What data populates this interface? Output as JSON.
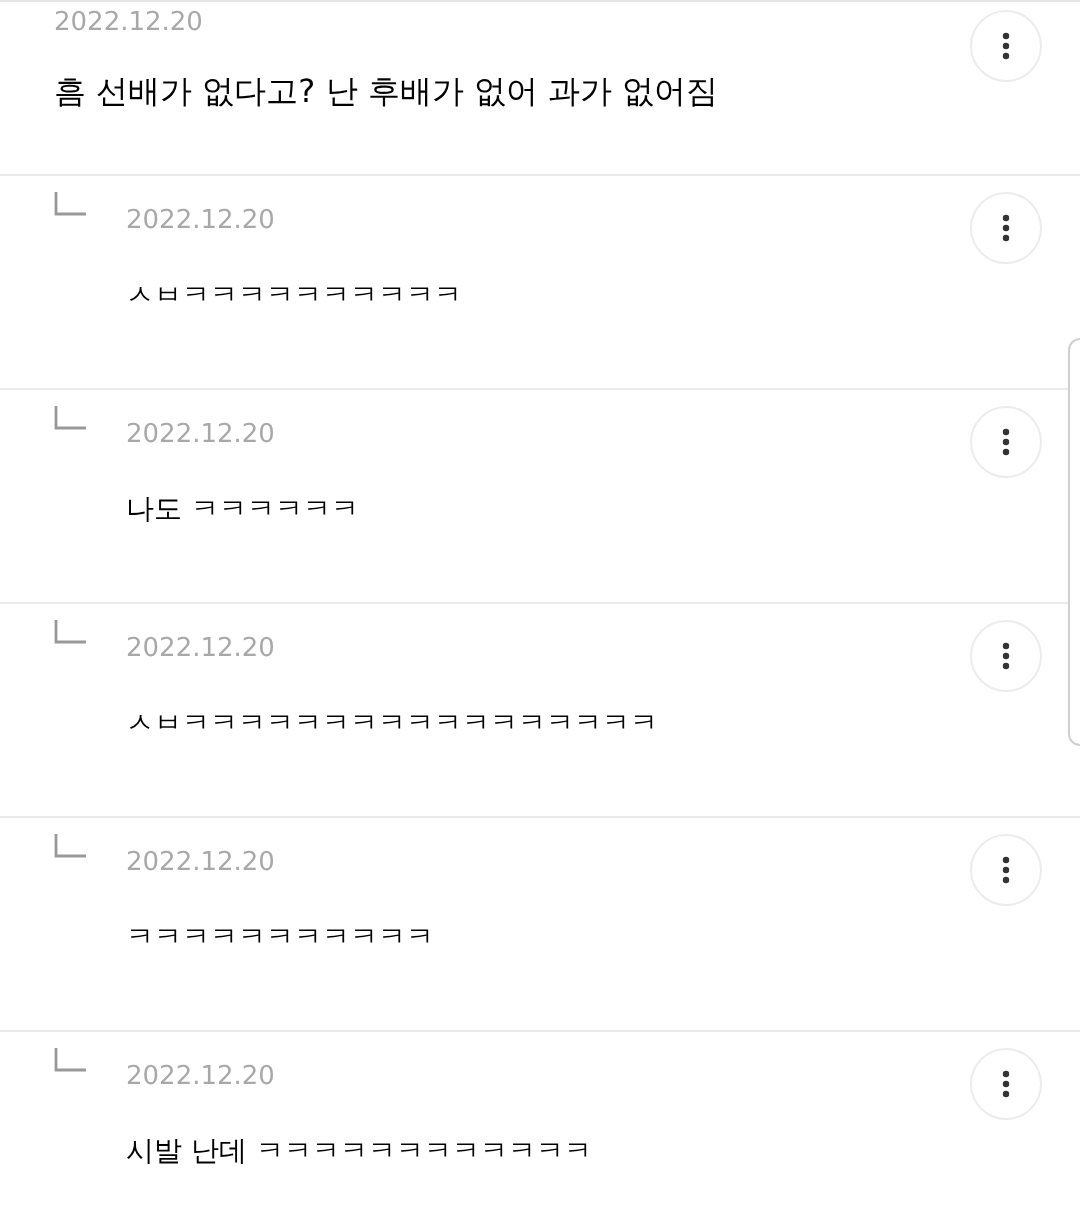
{
  "comments": [
    {
      "kind": "comment",
      "date": "2022.12.20",
      "text": "흠 선배가 없다고? 난 후배가 없어 과가 없어짐"
    },
    {
      "kind": "reply",
      "date": "2022.12.20",
      "text": "ㅅㅂㅋㅋㅋㅋㅋㅋㅋㅋㅋㅋ"
    },
    {
      "kind": "reply",
      "date": "2022.12.20",
      "text": "나도 ㅋㅋㅋㅋㅋㅋ"
    },
    {
      "kind": "reply",
      "date": "2022.12.20",
      "text": "ㅅㅂㅋㅋㅋㅋㅋㅋㅋㅋㅋㅋㅋㅋㅋㅋㅋㅋㅋ"
    },
    {
      "kind": "reply",
      "date": "2022.12.20",
      "text": "ㅋㅋㅋㅋㅋㅋㅋㅋㅋㅋㅋ"
    },
    {
      "kind": "reply",
      "date": "2022.12.20",
      "text": "시발 난데 ㅋㅋㅋㅋㅋㅋㅋㅋㅋㅋㅋㅋ"
    }
  ]
}
